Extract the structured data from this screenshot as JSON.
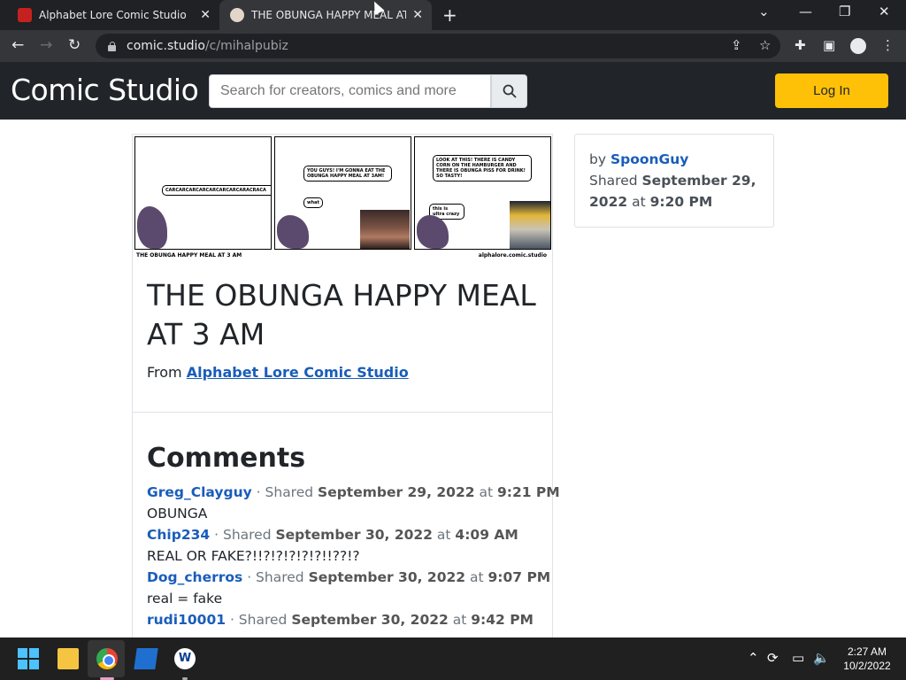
{
  "browser": {
    "tabs": [
      {
        "title": "Alphabet Lore Comic Studio",
        "active": false
      },
      {
        "title": "THE OBUNGA HAPPY MEAL AT 3 AM",
        "active": true
      }
    ],
    "new_tab": "+",
    "url_host": "comic.studio",
    "url_path": "/c/mihalpubiz"
  },
  "site": {
    "logo": "Comic Studio",
    "search_placeholder": "Search for creators, comics and more",
    "login_label": "Log In"
  },
  "comic": {
    "panels": [
      {
        "bubble": "CARCARCARCARCARCARCARCARACRACA"
      },
      {
        "bubble": "YOU GUYS! I'M GONNA EAT THE OBUNGA HAPPY MEAL AT 3AM!",
        "reply": "what"
      },
      {
        "bubble": "LOOK AT THIS! THERE IS CANDY CORN ON THE HAMBURGER AND THERE IS OBUNGA PISS FOR DRINK! SO TASTY!",
        "reply": "this is ultra crazy"
      }
    ],
    "caption_left": "THE OBUNGA HAPPY MEAL AT 3 AM",
    "caption_right": "alphalore.comic.studio",
    "title": "THE OBUNGA HAPPY MEAL AT 3 AM",
    "from_label": "From",
    "from_studio": "Alphabet Lore Comic Studio"
  },
  "info": {
    "by_label": "by",
    "author": "SpoonGuy",
    "shared_label": "Shared",
    "date": "September 29, 2022",
    "at_label": "at",
    "time": "9:20 PM"
  },
  "comments": {
    "heading": "Comments",
    "items": [
      {
        "user": "Greg_Clayguy",
        "date": "September 29, 2022",
        "time": "9:21 PM",
        "text": "OBUNGA"
      },
      {
        "user": "Chip234",
        "date": "September 30, 2022",
        "time": "4:09 AM",
        "text": "REAL OR FAKE?!!?!?!?!?!?!!??!?"
      },
      {
        "user": "Dog_cherros",
        "date": "September 30, 2022",
        "time": "9:07 PM",
        "text": "real = fake"
      },
      {
        "user": "rudi10001",
        "date": "September 30, 2022",
        "time": "9:42 PM",
        "text": ""
      }
    ]
  },
  "taskbar": {
    "time": "2:27 AM",
    "date": "10/2/2022"
  }
}
